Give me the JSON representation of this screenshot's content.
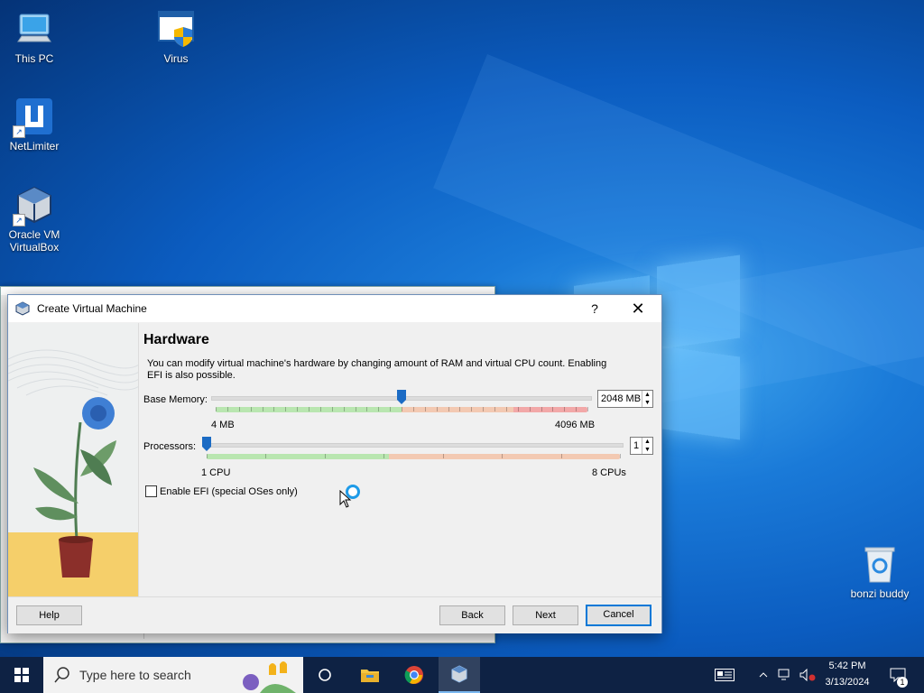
{
  "desktop": {
    "icons": [
      {
        "label": "This PC",
        "icon": "computer-icon"
      },
      {
        "label": "Virus",
        "icon": "shield-window-icon"
      },
      {
        "label": "NetLimiter",
        "icon": "netlimiter-icon"
      },
      {
        "label": "Oracle VM VirtualBox",
        "icon": "virtualbox-icon"
      },
      {
        "label": "bonzi buddy",
        "icon": "recycle-bin-icon"
      }
    ]
  },
  "dialog": {
    "title": "Create Virtual Machine",
    "help_glyph": "?",
    "close_glyph": "✕",
    "heading": "Hardware",
    "description": "You can modify virtual machine's hardware by changing amount of RAM and virtual CPU count. Enabling EFI is also possible.",
    "memory": {
      "label": "Base Memory:",
      "value": "2048 MB",
      "min_label": "4 MB",
      "max_label": "4096 MB",
      "fraction": 0.5
    },
    "processors": {
      "label": "Processors:",
      "value": "1",
      "min_label": "1 CPU",
      "max_label": "8 CPUs",
      "fraction": 0.0
    },
    "efi": {
      "label": "Enable EFI (special OSes only)",
      "checked": false
    },
    "buttons": {
      "help": "Help",
      "back": "Back",
      "next": "Next",
      "cancel": "Cancel"
    }
  },
  "taskbar": {
    "search_placeholder": "Type here to search",
    "apps": [
      "task-view-icon",
      "file-explorer-icon",
      "chrome-icon",
      "virtualbox-icon"
    ],
    "time": "5:42 PM",
    "date": "3/13/2024",
    "notification_count": "1"
  },
  "colors": {
    "accent": "#0078d7",
    "slider_green": "#b9e6b0",
    "slider_orange": "#f3c9b2",
    "slider_red": "#f2a8a8",
    "taskbar": "#0e2244"
  }
}
